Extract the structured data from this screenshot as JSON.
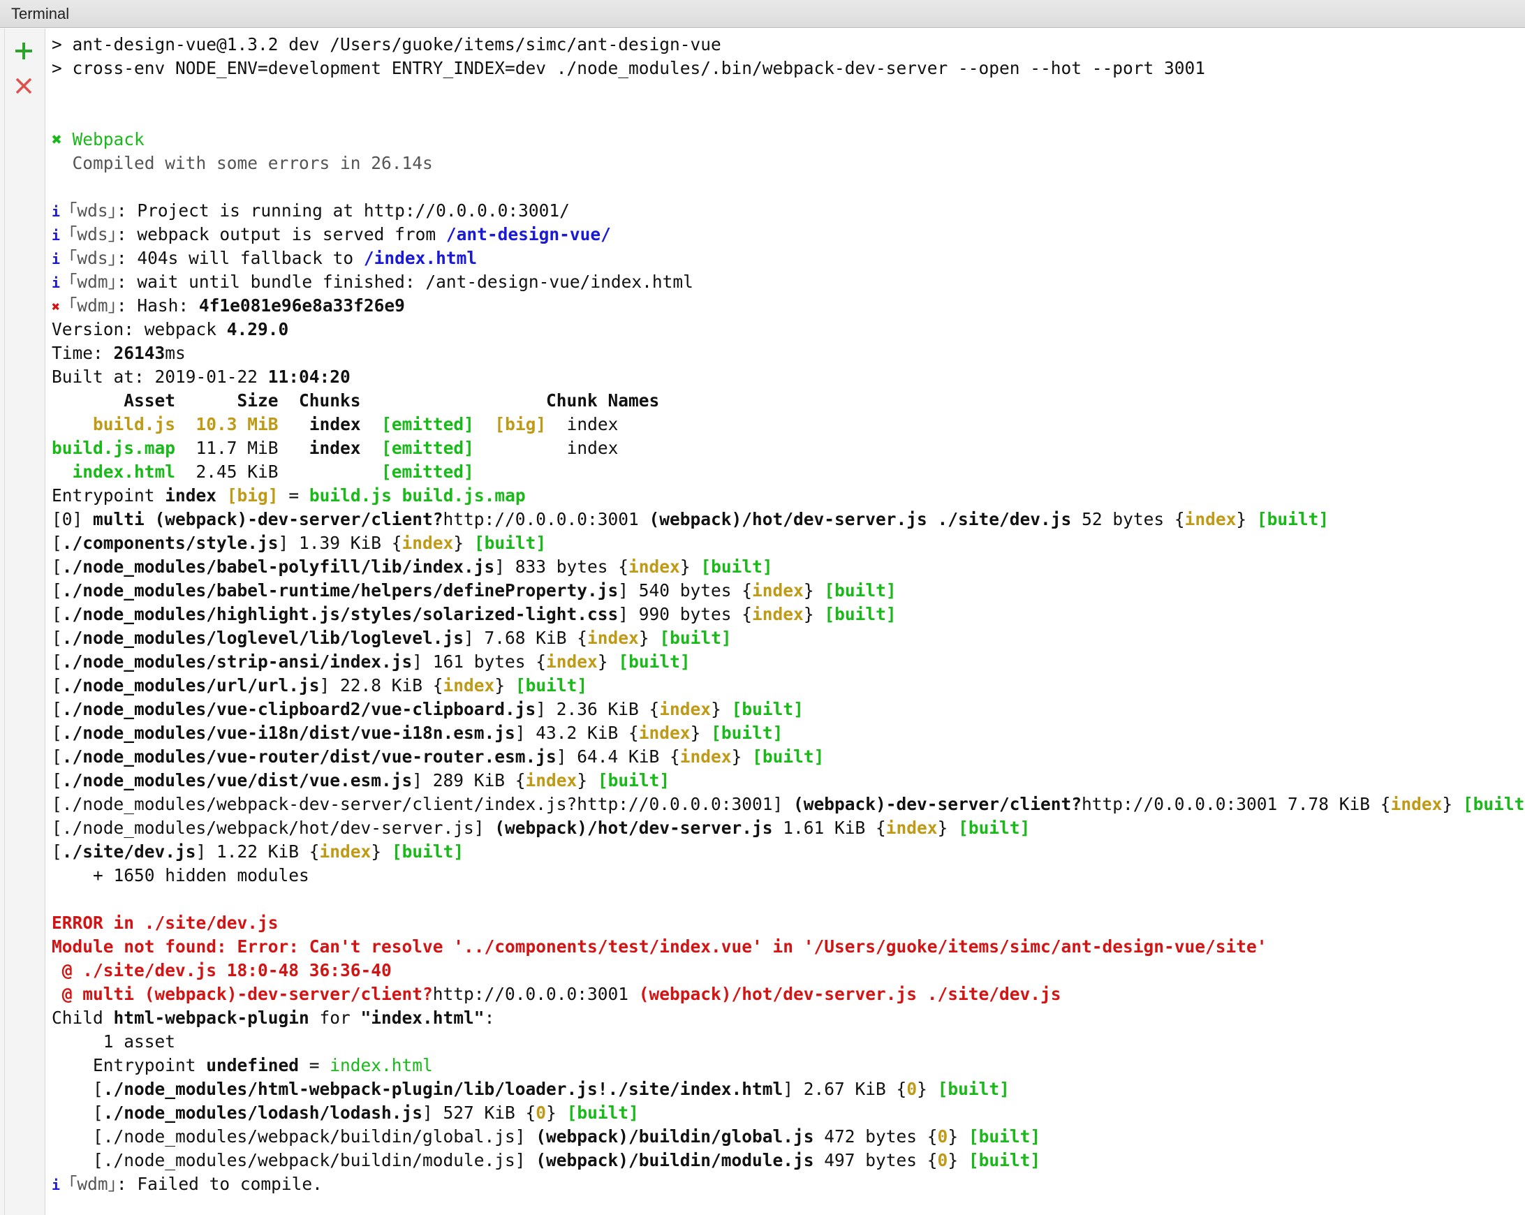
{
  "window": {
    "title": "Terminal"
  },
  "toolbar": {
    "add_label": "+",
    "close_label": "×"
  },
  "colors": {
    "green": "#19b919",
    "yellow": "#bf9a16",
    "red": "#d21414",
    "blue": "#1a1ad6"
  },
  "lines": [
    [
      {
        "t": "> ant-design-vue@1.3.2 dev /Users/guoke/items/simc/ant-design-vue"
      }
    ],
    [
      {
        "t": "> cross-env NODE_ENV=development ENTRY_INDEX=dev ./node_modules/.bin/webpack-dev-server --open --hot --port 3001"
      }
    ],
    [],
    [],
    [
      {
        "t": "✖ ",
        "c": "g b"
      },
      {
        "t": "Webpack",
        "c": "g"
      }
    ],
    [
      {
        "t": "  Compiled with some errors in 26.14s",
        "c": "gr"
      }
    ],
    [],
    [
      {
        "t": "i ",
        "c": "ic"
      },
      {
        "t": "｢wds｣",
        "c": "gr"
      },
      {
        "t": ": Project is running at http://0.0.0.0:3001/"
      }
    ],
    [
      {
        "t": "i ",
        "c": "ic"
      },
      {
        "t": "｢wds｣",
        "c": "gr"
      },
      {
        "t": ": webpack output is served from "
      },
      {
        "t": "/ant-design-vue/",
        "c": "bl b"
      }
    ],
    [
      {
        "t": "i ",
        "c": "ic"
      },
      {
        "t": "｢wds｣",
        "c": "gr"
      },
      {
        "t": ": 404s will fallback to "
      },
      {
        "t": "/index.html",
        "c": "bl b"
      }
    ],
    [
      {
        "t": "i ",
        "c": "ic"
      },
      {
        "t": "｢wdm｣",
        "c": "gr"
      },
      {
        "t": ": wait until bundle finished: /ant-design-vue/index.html"
      }
    ],
    [
      {
        "t": "✖ ",
        "c": "ex"
      },
      {
        "t": "｢wdm｣",
        "c": "gr"
      },
      {
        "t": ": Hash: "
      },
      {
        "t": "4f1e081e96e8a33f26e9",
        "c": "b"
      }
    ],
    [
      {
        "t": "Version: webpack "
      },
      {
        "t": "4.29.0",
        "c": "b"
      }
    ],
    [
      {
        "t": "Time: "
      },
      {
        "t": "26143",
        "c": "b"
      },
      {
        "t": "ms"
      }
    ],
    [
      {
        "t": "Built at: 2019-01-22 "
      },
      {
        "t": "11:04:20",
        "c": "b"
      }
    ],
    [
      {
        "t": "       Asset      Size  Chunks                  Chunk Names",
        "c": "b"
      }
    ],
    [
      {
        "t": "    "
      },
      {
        "t": "build.js",
        "c": "y b"
      },
      {
        "t": "  "
      },
      {
        "t": "10.3 MiB",
        "c": "y b"
      },
      {
        "t": "   "
      },
      {
        "t": "index",
        "c": "b"
      },
      {
        "t": "  "
      },
      {
        "t": "[emitted]",
        "c": "g b"
      },
      {
        "t": "  "
      },
      {
        "t": "[big]",
        "c": "y b"
      },
      {
        "t": "  index"
      }
    ],
    [
      {
        "t": "build.js.map",
        "c": "g b"
      },
      {
        "t": "  11.7 MiB   "
      },
      {
        "t": "index",
        "c": "b"
      },
      {
        "t": "  "
      },
      {
        "t": "[emitted]",
        "c": "g b"
      },
      {
        "t": "         index"
      }
    ],
    [
      {
        "t": "  "
      },
      {
        "t": "index.html",
        "c": "g b"
      },
      {
        "t": "  2.45 KiB          "
      },
      {
        "t": "[emitted]",
        "c": "g b"
      }
    ],
    [
      {
        "t": "Entrypoint "
      },
      {
        "t": "index",
        "c": "b"
      },
      {
        "t": " "
      },
      {
        "t": "[big]",
        "c": "y b"
      },
      {
        "t": " = "
      },
      {
        "t": "build.js build.js.map",
        "c": "g b"
      }
    ],
    [
      {
        "t": "[0] "
      },
      {
        "t": "multi (webpack)-dev-server/client?",
        "c": "b"
      },
      {
        "t": "http://0.0.0.0:3001 "
      },
      {
        "t": "(webpack)/hot/dev-server.js ./site/dev.js",
        "c": "b"
      },
      {
        "t": " 52 bytes {"
      },
      {
        "t": "index",
        "c": "y b"
      },
      {
        "t": "} "
      },
      {
        "t": "[built]",
        "c": "g b"
      }
    ],
    [
      {
        "t": "["
      },
      {
        "t": "./components/style.js",
        "c": "b"
      },
      {
        "t": "] 1.39 KiB {"
      },
      {
        "t": "index",
        "c": "y b"
      },
      {
        "t": "} "
      },
      {
        "t": "[built]",
        "c": "g b"
      }
    ],
    [
      {
        "t": "["
      },
      {
        "t": "./node_modules/babel-polyfill/lib/index.js",
        "c": "b"
      },
      {
        "t": "] 833 bytes {"
      },
      {
        "t": "index",
        "c": "y b"
      },
      {
        "t": "} "
      },
      {
        "t": "[built]",
        "c": "g b"
      }
    ],
    [
      {
        "t": "["
      },
      {
        "t": "./node_modules/babel-runtime/helpers/defineProperty.js",
        "c": "b"
      },
      {
        "t": "] 540 bytes {"
      },
      {
        "t": "index",
        "c": "y b"
      },
      {
        "t": "} "
      },
      {
        "t": "[built]",
        "c": "g b"
      }
    ],
    [
      {
        "t": "["
      },
      {
        "t": "./node_modules/highlight.js/styles/solarized-light.css",
        "c": "b"
      },
      {
        "t": "] 990 bytes {"
      },
      {
        "t": "index",
        "c": "y b"
      },
      {
        "t": "} "
      },
      {
        "t": "[built]",
        "c": "g b"
      }
    ],
    [
      {
        "t": "["
      },
      {
        "t": "./node_modules/loglevel/lib/loglevel.js",
        "c": "b"
      },
      {
        "t": "] 7.68 KiB {"
      },
      {
        "t": "index",
        "c": "y b"
      },
      {
        "t": "} "
      },
      {
        "t": "[built]",
        "c": "g b"
      }
    ],
    [
      {
        "t": "["
      },
      {
        "t": "./node_modules/strip-ansi/index.js",
        "c": "b"
      },
      {
        "t": "] 161 bytes {"
      },
      {
        "t": "index",
        "c": "y b"
      },
      {
        "t": "} "
      },
      {
        "t": "[built]",
        "c": "g b"
      }
    ],
    [
      {
        "t": "["
      },
      {
        "t": "./node_modules/url/url.js",
        "c": "b"
      },
      {
        "t": "] 22.8 KiB {"
      },
      {
        "t": "index",
        "c": "y b"
      },
      {
        "t": "} "
      },
      {
        "t": "[built]",
        "c": "g b"
      }
    ],
    [
      {
        "t": "["
      },
      {
        "t": "./node_modules/vue-clipboard2/vue-clipboard.js",
        "c": "b"
      },
      {
        "t": "] 2.36 KiB {"
      },
      {
        "t": "index",
        "c": "y b"
      },
      {
        "t": "} "
      },
      {
        "t": "[built]",
        "c": "g b"
      }
    ],
    [
      {
        "t": "["
      },
      {
        "t": "./node_modules/vue-i18n/dist/vue-i18n.esm.js",
        "c": "b"
      },
      {
        "t": "] 43.2 KiB {"
      },
      {
        "t": "index",
        "c": "y b"
      },
      {
        "t": "} "
      },
      {
        "t": "[built]",
        "c": "g b"
      }
    ],
    [
      {
        "t": "["
      },
      {
        "t": "./node_modules/vue-router/dist/vue-router.esm.js",
        "c": "b"
      },
      {
        "t": "] 64.4 KiB {"
      },
      {
        "t": "index",
        "c": "y b"
      },
      {
        "t": "} "
      },
      {
        "t": "[built]",
        "c": "g b"
      }
    ],
    [
      {
        "t": "["
      },
      {
        "t": "./node_modules/vue/dist/vue.esm.js",
        "c": "b"
      },
      {
        "t": "] 289 KiB {"
      },
      {
        "t": "index",
        "c": "y b"
      },
      {
        "t": "} "
      },
      {
        "t": "[built]",
        "c": "g b"
      }
    ],
    [
      {
        "t": "[./node_modules/webpack-dev-server/client/index.js?http://0.0.0.0:3001] "
      },
      {
        "t": "(webpack)-dev-server/client?",
        "c": "b"
      },
      {
        "t": "http://0.0.0.0:3001 7.78 KiB {"
      },
      {
        "t": "index",
        "c": "y b"
      },
      {
        "t": "} "
      },
      {
        "t": "[built]",
        "c": "g b"
      }
    ],
    [
      {
        "t": "[./node_modules/webpack/hot/dev-server.js] "
      },
      {
        "t": "(webpack)/hot/dev-server.js",
        "c": "b"
      },
      {
        "t": " 1.61 KiB {"
      },
      {
        "t": "index",
        "c": "y b"
      },
      {
        "t": "} "
      },
      {
        "t": "[built]",
        "c": "g b"
      }
    ],
    [
      {
        "t": "["
      },
      {
        "t": "./site/dev.js",
        "c": "b"
      },
      {
        "t": "] 1.22 KiB {"
      },
      {
        "t": "index",
        "c": "y b"
      },
      {
        "t": "} "
      },
      {
        "t": "[built]",
        "c": "g b"
      }
    ],
    [
      {
        "t": "    + 1650 hidden modules"
      }
    ],
    [],
    [
      {
        "t": "ERROR in ./site/dev.js",
        "c": "r b"
      }
    ],
    [
      {
        "t": "Module not found: Error: Can't resolve '../components/test/index.vue' in '/Users/guoke/items/simc/ant-design-vue/site'",
        "c": "r b"
      }
    ],
    [
      {
        "t": " @ ./site/dev.js 18:0-48 36:36-40",
        "c": "r b"
      }
    ],
    [
      {
        "t": " @ multi (webpack)-dev-server/client?",
        "c": "r b"
      },
      {
        "t": "http://0.0.0.0:3001 "
      },
      {
        "t": "(webpack)/hot/dev-server.js ./site/dev.js",
        "c": "r b"
      }
    ],
    [
      {
        "t": "Child "
      },
      {
        "t": "html-webpack-plugin",
        "c": "b"
      },
      {
        "t": " for "
      },
      {
        "t": "\"index.html\"",
        "c": "b"
      },
      {
        "t": ":"
      }
    ],
    [
      {
        "t": "     1 asset"
      }
    ],
    [
      {
        "t": "    Entrypoint "
      },
      {
        "t": "undefined",
        "c": "b"
      },
      {
        "t": " = "
      },
      {
        "t": "index.html",
        "c": "g"
      }
    ],
    [
      {
        "t": "    ["
      },
      {
        "t": "./node_modules/html-webpack-plugin/lib/loader.js!./site/index.html",
        "c": "b"
      },
      {
        "t": "] 2.67 KiB {"
      },
      {
        "t": "0",
        "c": "y b"
      },
      {
        "t": "} "
      },
      {
        "t": "[built]",
        "c": "g b"
      }
    ],
    [
      {
        "t": "    ["
      },
      {
        "t": "./node_modules/lodash/lodash.js",
        "c": "b"
      },
      {
        "t": "] 527 KiB {"
      },
      {
        "t": "0",
        "c": "y b"
      },
      {
        "t": "} "
      },
      {
        "t": "[built]",
        "c": "g b"
      }
    ],
    [
      {
        "t": "    [./node_modules/webpack/buildin/global.js] "
      },
      {
        "t": "(webpack)/buildin/global.js",
        "c": "b"
      },
      {
        "t": " 472 bytes {"
      },
      {
        "t": "0",
        "c": "y b"
      },
      {
        "t": "} "
      },
      {
        "t": "[built]",
        "c": "g b"
      }
    ],
    [
      {
        "t": "    [./node_modules/webpack/buildin/module.js] "
      },
      {
        "t": "(webpack)/buildin/module.js",
        "c": "b"
      },
      {
        "t": " 497 bytes {"
      },
      {
        "t": "0",
        "c": "y b"
      },
      {
        "t": "} "
      },
      {
        "t": "[built]",
        "c": "g b"
      }
    ],
    [
      {
        "t": "i ",
        "c": "ic"
      },
      {
        "t": "｢wdm｣",
        "c": "gr"
      },
      {
        "t": ": Failed to compile."
      }
    ]
  ]
}
